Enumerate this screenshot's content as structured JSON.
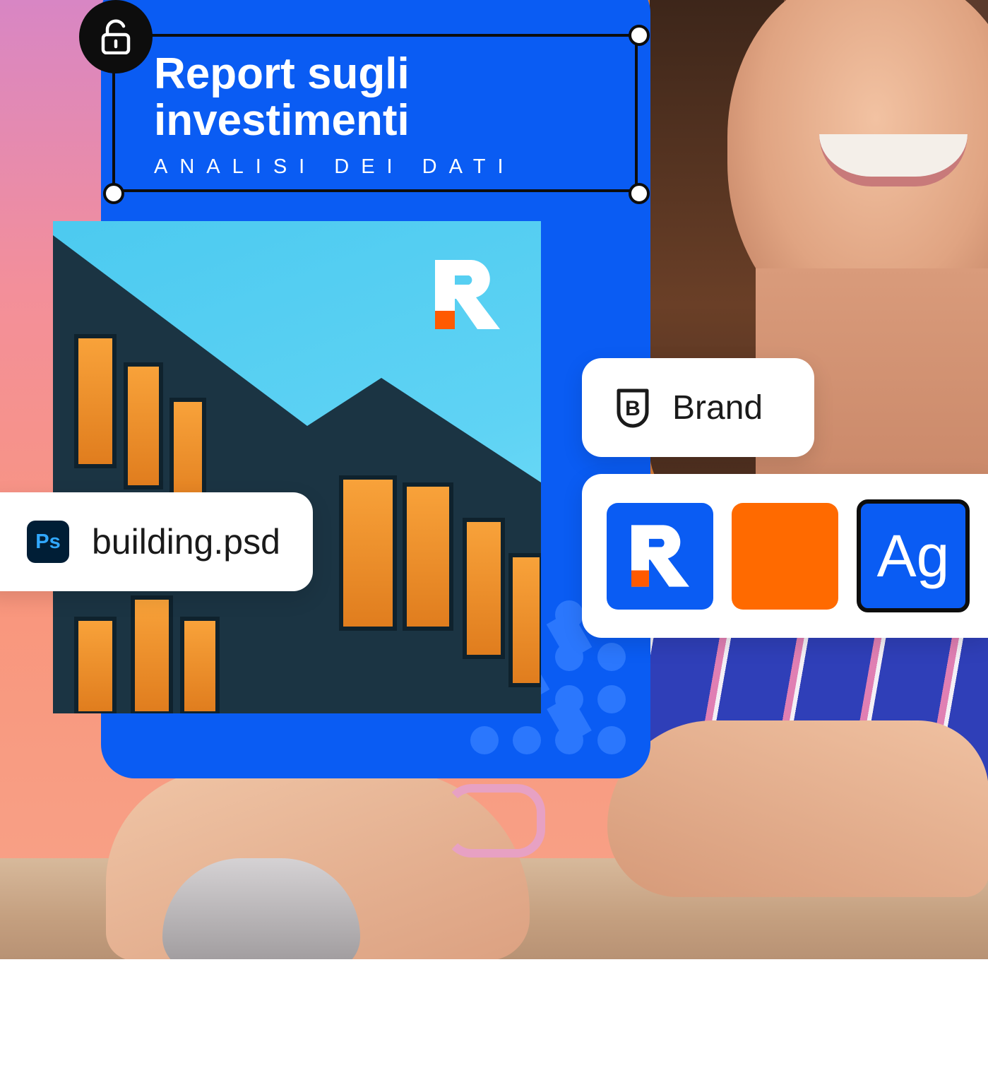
{
  "document": {
    "title": "Report sugli investimenti",
    "subtitle": "ANALISI DEI DATI"
  },
  "file_chip": {
    "app_icon": "Ps",
    "file_name": "building.psd"
  },
  "brand_chip": {
    "label": "Brand",
    "icon": "brand-b-icon"
  },
  "brand_kit": {
    "type_sample": "Ag",
    "colors": {
      "primary": "#0a5cf3",
      "accent": "#ff6a00"
    }
  },
  "lock_state": "unlocked"
}
